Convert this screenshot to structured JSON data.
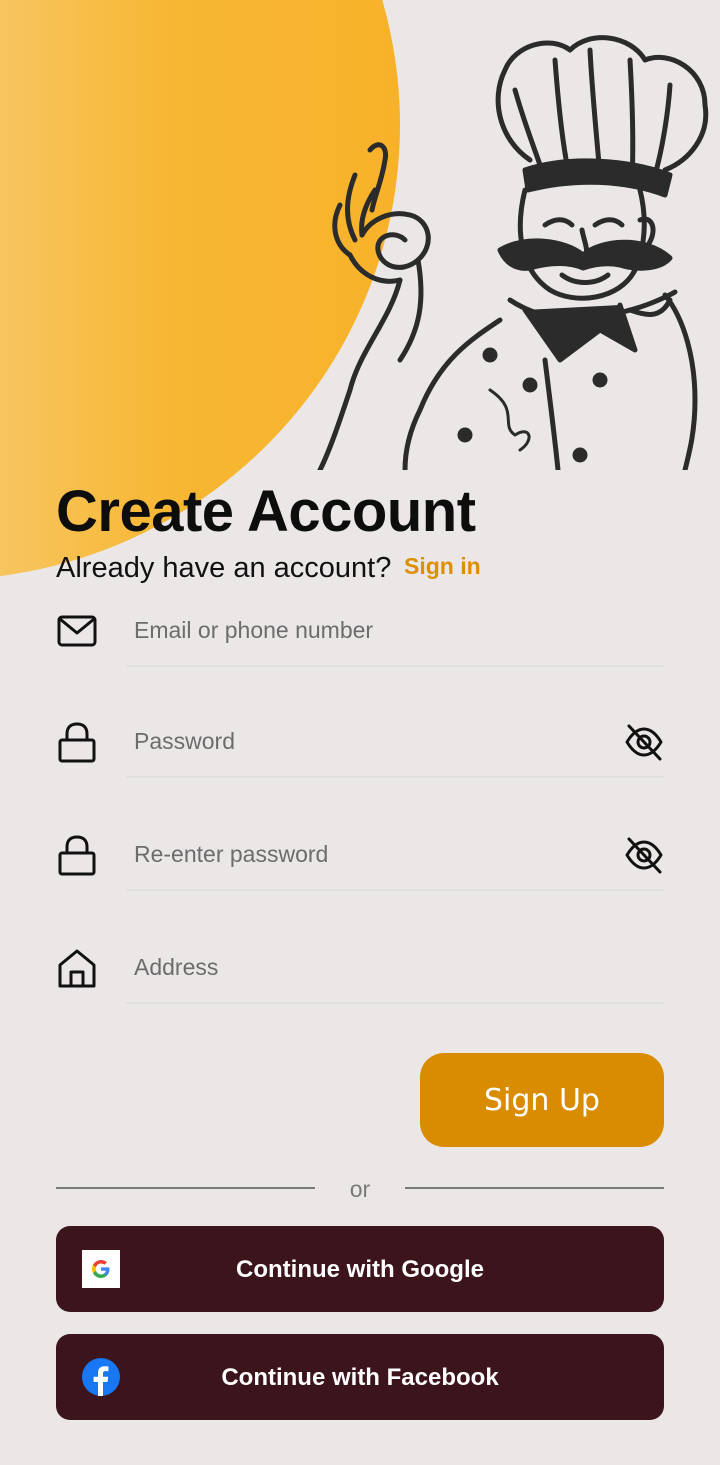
{
  "header": {
    "title": "Create Account",
    "subtitle": "Already have an account?",
    "signin_link": "Sign in"
  },
  "form": {
    "email": {
      "placeholder": "Email or phone number",
      "icon": "mail-icon"
    },
    "password": {
      "placeholder": "Password",
      "icon": "lock-icon"
    },
    "confirm_password": {
      "placeholder": "Re-enter password",
      "icon": "lock-icon"
    },
    "address": {
      "placeholder": "Address",
      "icon": "home-icon"
    }
  },
  "signup_label": "Sign Up",
  "divider_text": "or",
  "social": {
    "google_label": "Continue with Google",
    "facebook_label": "Continue with Facebook"
  },
  "colors": {
    "background": "#ebe7e7",
    "accent": "#d98c00",
    "social_button": "#3c141b",
    "blob": "#f8b22a"
  }
}
